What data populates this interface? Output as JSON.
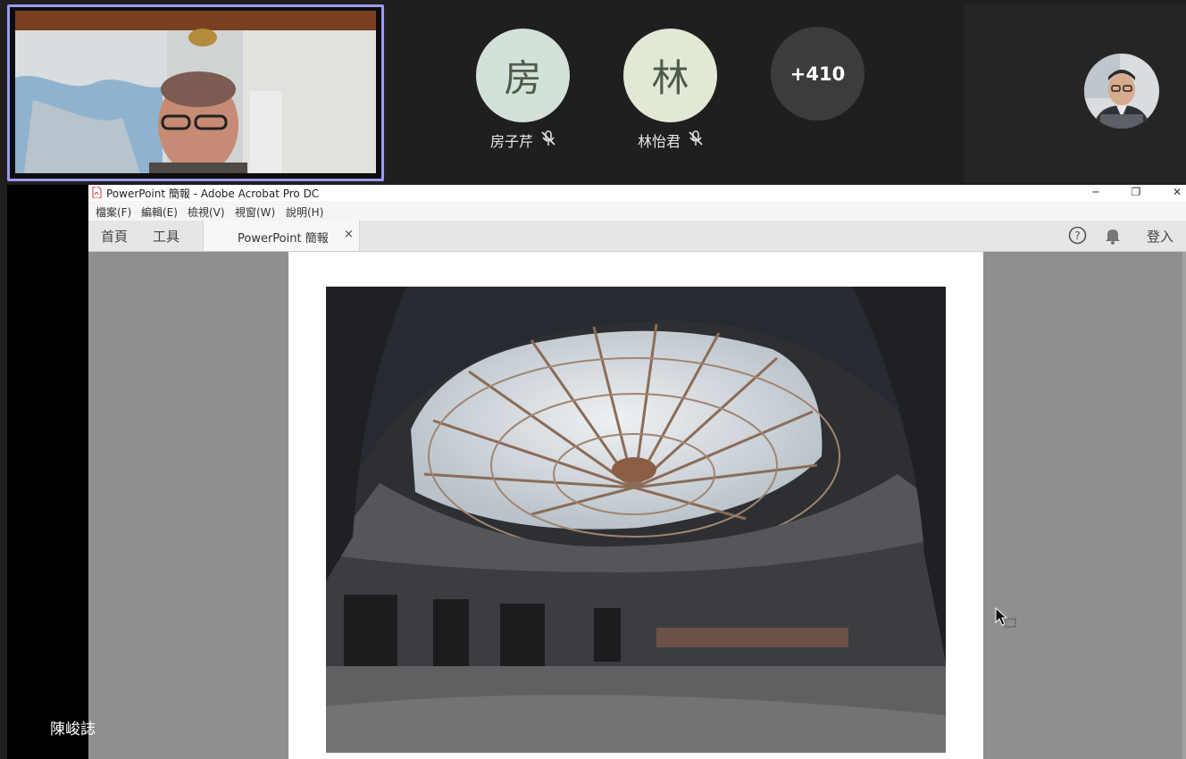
{
  "participants": {
    "speaker_tile": {
      "name": "陳峻誌"
    },
    "tiles": [
      {
        "initial": "房",
        "name": "房子芹",
        "bg": "#d3e1d8",
        "muted": true
      },
      {
        "initial": "林",
        "name": "林怡君",
        "bg": "#e2e8d6",
        "muted": true
      }
    ],
    "more_count": "+410"
  },
  "acrobat": {
    "window_title": "PowerPoint 簡報 - Adobe Acrobat Pro DC",
    "menu": [
      "檔案(F)",
      "編輯(E)",
      "檢視(V)",
      "視窗(W)",
      "說明(H)"
    ],
    "nav": {
      "home": "首頁",
      "tools": "工具"
    },
    "doc_tab": {
      "label": "PowerPoint 簡報",
      "close": "×"
    },
    "toolbar_right": {
      "help": "?",
      "sign_in": "登入"
    }
  },
  "colors": {
    "speaker_border": "#9b9bf7",
    "app_bg": "#1f1f1f",
    "acrobat_gray": "#8f8f8f"
  }
}
